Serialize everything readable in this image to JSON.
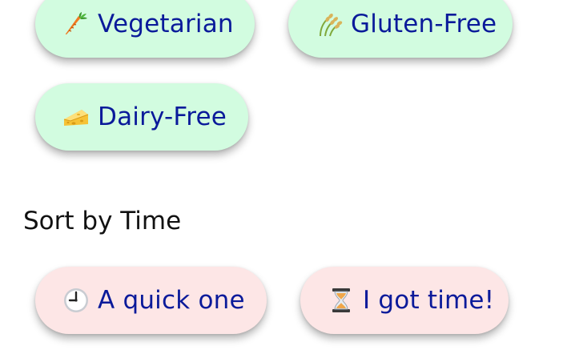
{
  "filters": {
    "vegetarian": {
      "label": "Vegetarian",
      "icon": "carrot-icon"
    },
    "gluten_free": {
      "label": "Gluten-Free",
      "icon": "rice-plant-icon"
    },
    "dairy_free": {
      "label": "Dairy-Free",
      "icon": "cheese-icon"
    }
  },
  "sort_section": {
    "title": "Sort by Time",
    "options": {
      "quick": {
        "label": "A quick one",
        "icon": "clock-icon"
      },
      "long": {
        "label": "I got time!",
        "icon": "hourglass-icon"
      }
    }
  },
  "colors": {
    "filter_pill_bg": "#d2fce0",
    "sort_pill_bg": "#fde6e6",
    "pill_text": "#0a1a9a",
    "heading_text": "#111111"
  }
}
